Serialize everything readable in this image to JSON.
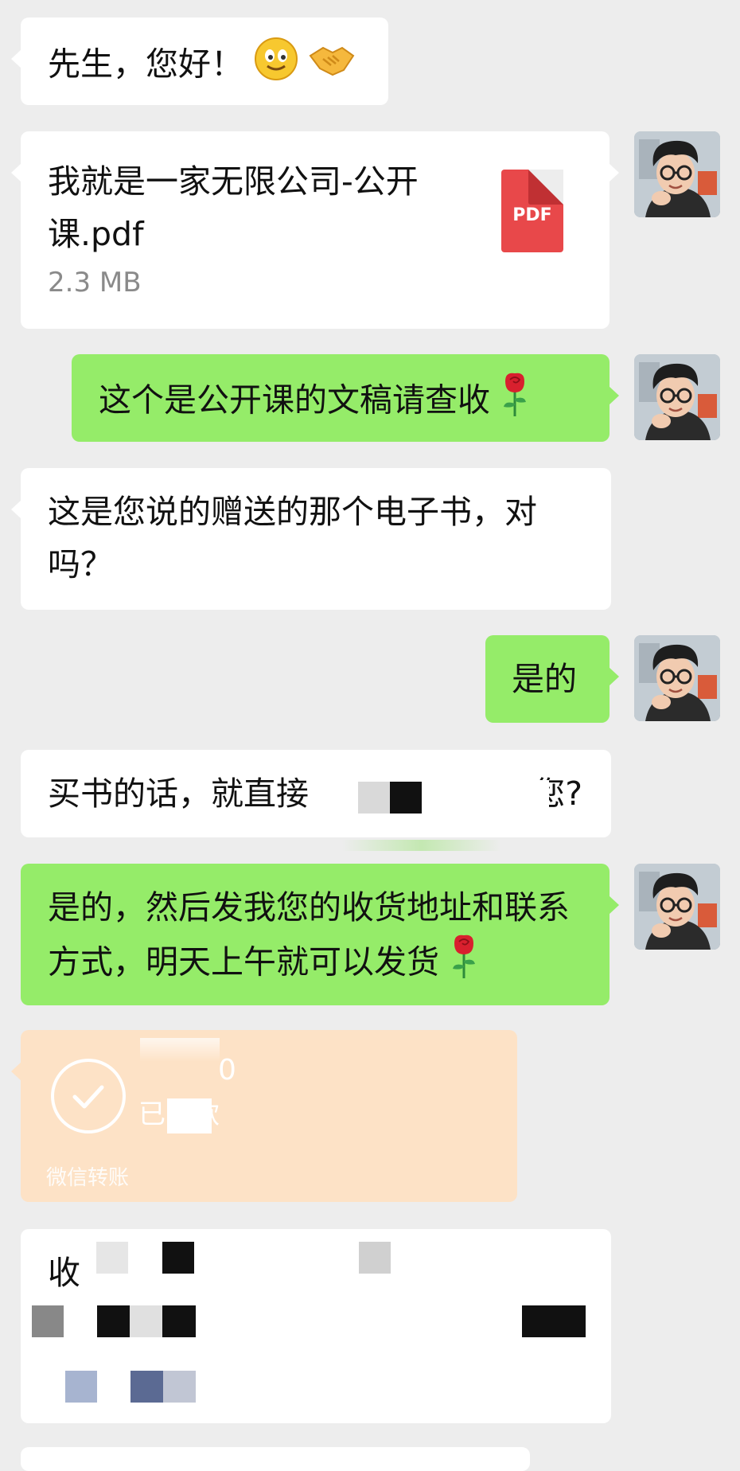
{
  "messages": [
    {
      "text": "先生，您好！",
      "emoji": "smile-emoji handshake-emoji"
    },
    {
      "file_name": "我就是一家无限公司-公开课.pdf",
      "file_size": "2.3 MB",
      "file_badge": "PDF"
    },
    {
      "text": "这个是公开课的文稿请查收",
      "emoji": "rose-emoji"
    },
    {
      "text": "这是您说的赠送的那个电子书，对吗？"
    },
    {
      "text": "是的"
    },
    {
      "text_start": "买书的话，就直接",
      "text_end": "您?"
    },
    {
      "text": "是的，然后发我您的收货地址和联系方式，明天上午就可以发货",
      "emoji": "rose-emoji"
    },
    {
      "transfer_amount": "0",
      "transfer_status": "已收款",
      "transfer_label": "微信转账"
    },
    {
      "text_start": "收"
    }
  ],
  "colors": {
    "background": "#ededed",
    "incoming_bubble": "#ffffff",
    "outgoing_bubble": "#95ec69",
    "transfer_bubble": "#fde2c6",
    "pdf_badge": "#e8484a"
  }
}
